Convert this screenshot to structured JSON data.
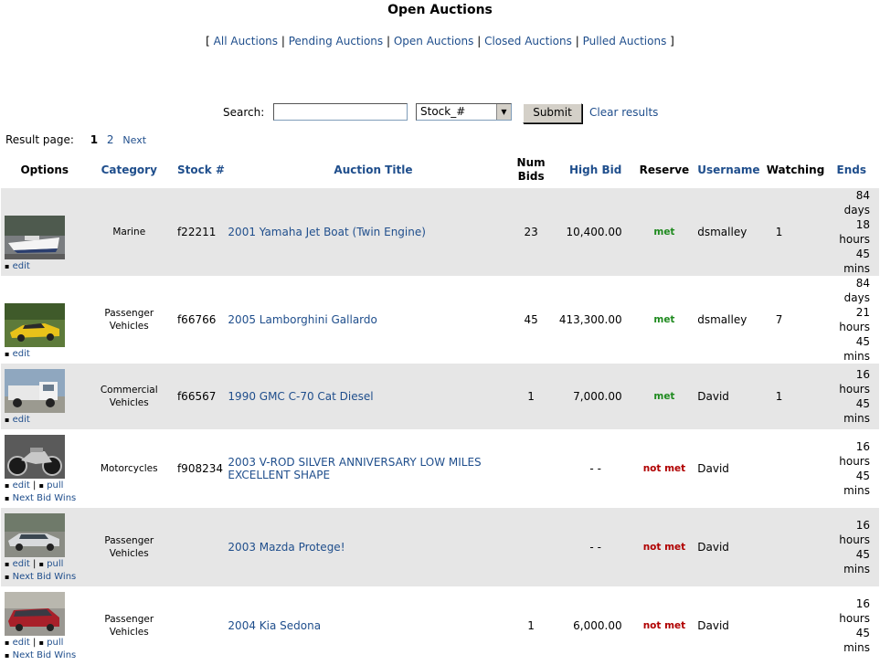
{
  "page": {
    "title": "Open Auctions"
  },
  "nav": {
    "open": "[",
    "close": "]",
    "sep": "|",
    "items": [
      "All Auctions",
      "Pending Auctions",
      "Open Auctions",
      "Closed Auctions",
      "Pulled Auctions"
    ]
  },
  "search": {
    "label": "Search:",
    "value": "",
    "select_value": "Stock_#",
    "submit": "Submit",
    "clear": "Clear results"
  },
  "pagination": {
    "label": "Result page:",
    "current": "1",
    "other": "2",
    "next": "Next"
  },
  "columns": {
    "options": "Options",
    "category": "Category",
    "stock": "Stock #",
    "title": "Auction Title",
    "num_bids_1": "Num",
    "num_bids_2": "Bids",
    "high_bid": "High Bid",
    "reserve": "Reserve",
    "username": "Username",
    "watching": "Watching",
    "ends": "Ends"
  },
  "actions": {
    "edit": "edit",
    "pull": "pull",
    "next_bid_wins": "Next Bid Wins",
    "bullet": "▪"
  },
  "rows": [
    {
      "cat1": "Marine",
      "cat2": "",
      "stock": "f22211",
      "title1": "2001 Yamaha Jet Boat (Twin Engine)",
      "title2": "",
      "bids": "23",
      "high_bid": "10,400.00",
      "reserve": "met",
      "user": "dsmalley",
      "watching": "1",
      "ends1": "84 days",
      "ends2": "18 hours",
      "ends3": "45 mins"
    },
    {
      "cat1": "Passenger",
      "cat2": "Vehicles",
      "stock": "f66766",
      "title1": "2005 Lamborghini Gallardo",
      "title2": "",
      "bids": "45",
      "high_bid": "413,300.00",
      "reserve": "met",
      "user": "dsmalley",
      "watching": "7",
      "ends1": "84 days",
      "ends2": "21 hours",
      "ends3": "45 mins"
    },
    {
      "cat1": "Commercial",
      "cat2": "Vehicles",
      "stock": "f66567",
      "title1": "1990 GMC C-70 Cat Diesel",
      "title2": "",
      "bids": "1",
      "high_bid": "7,000.00",
      "reserve": "met",
      "user": "David",
      "watching": "1",
      "ends1": "16 hours",
      "ends2": "45 mins",
      "ends3": ""
    },
    {
      "cat1": "Motorcycles",
      "cat2": "",
      "stock": "f908234",
      "title1": "2003 V-ROD SILVER ANNIVERSARY LOW MILES",
      "title2": "EXCELLENT SHAPE",
      "bids": "",
      "high_bid": "- -",
      "reserve": "not met",
      "user": "David",
      "watching": "",
      "ends1": "16 hours",
      "ends2": "45 mins",
      "ends3": ""
    },
    {
      "cat1": "Passenger",
      "cat2": "Vehicles",
      "stock": "",
      "title1": "2003 Mazda Protege!",
      "title2": "",
      "bids": "",
      "high_bid": "- -",
      "reserve": "not met",
      "user": "David",
      "watching": "",
      "ends1": "16 hours",
      "ends2": "45 mins",
      "ends3": ""
    },
    {
      "cat1": "Passenger",
      "cat2": "Vehicles",
      "stock": "",
      "title1": "2004 Kia Sedona",
      "title2": "",
      "bids": "1",
      "high_bid": "6,000.00",
      "reserve": "not met",
      "user": "David",
      "watching": "",
      "ends1": "16 hours",
      "ends2": "45 mins",
      "ends3": ""
    }
  ],
  "colors": {
    "link": "#1f4e8c",
    "met": "#1e8a1e",
    "not_met": "#b00000",
    "row_shade": "#e6e6e6"
  }
}
